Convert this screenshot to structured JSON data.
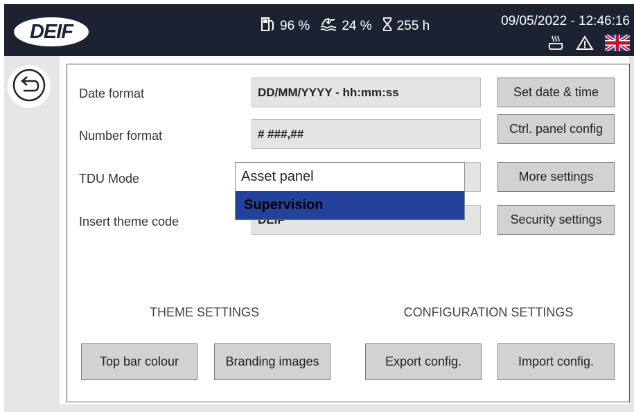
{
  "topbar": {
    "logo_text": "DEIF",
    "fuel": "96 %",
    "water": "24 %",
    "hours": "255 h",
    "datetime": "09/05/2022 - 12:46:16",
    "icons": [
      "fuel-pump-icon",
      "water-level-icon",
      "hourglass-icon",
      "heater-icon",
      "warning-icon",
      "uk-flag-icon"
    ]
  },
  "settings": {
    "date_format": {
      "label": "Date format",
      "value": "DD/MM/YYYY - hh:mm:ss"
    },
    "number_format": {
      "label": "Number format",
      "value": "# ###,##"
    },
    "tdu_mode": {
      "label": "TDU Mode",
      "value": "Asset panel"
    },
    "theme_code": {
      "label": "Insert theme code",
      "value": "DEIF"
    }
  },
  "dropdown": {
    "options": [
      "Asset panel",
      "Supervision"
    ],
    "highlighted": "Supervision"
  },
  "buttons": {
    "set_date_time": "Set date & time",
    "ctrl_panel_config": "Ctrl. panel config",
    "more_settings": "More settings",
    "security_settings": "Security settings",
    "top_bar_colour": "Top bar colour",
    "branding_images": "Branding images",
    "export_config": "Export config.",
    "import_config": "Import config."
  },
  "sections": {
    "theme": "THEME SETTINGS",
    "configuration": "CONFIGURATION SETTINGS"
  },
  "colors": {
    "topbar_bg": "#1b2333",
    "highlight": "#22429b",
    "button_bg": "#d2d2d2",
    "field_bg": "#e4e4e4"
  }
}
